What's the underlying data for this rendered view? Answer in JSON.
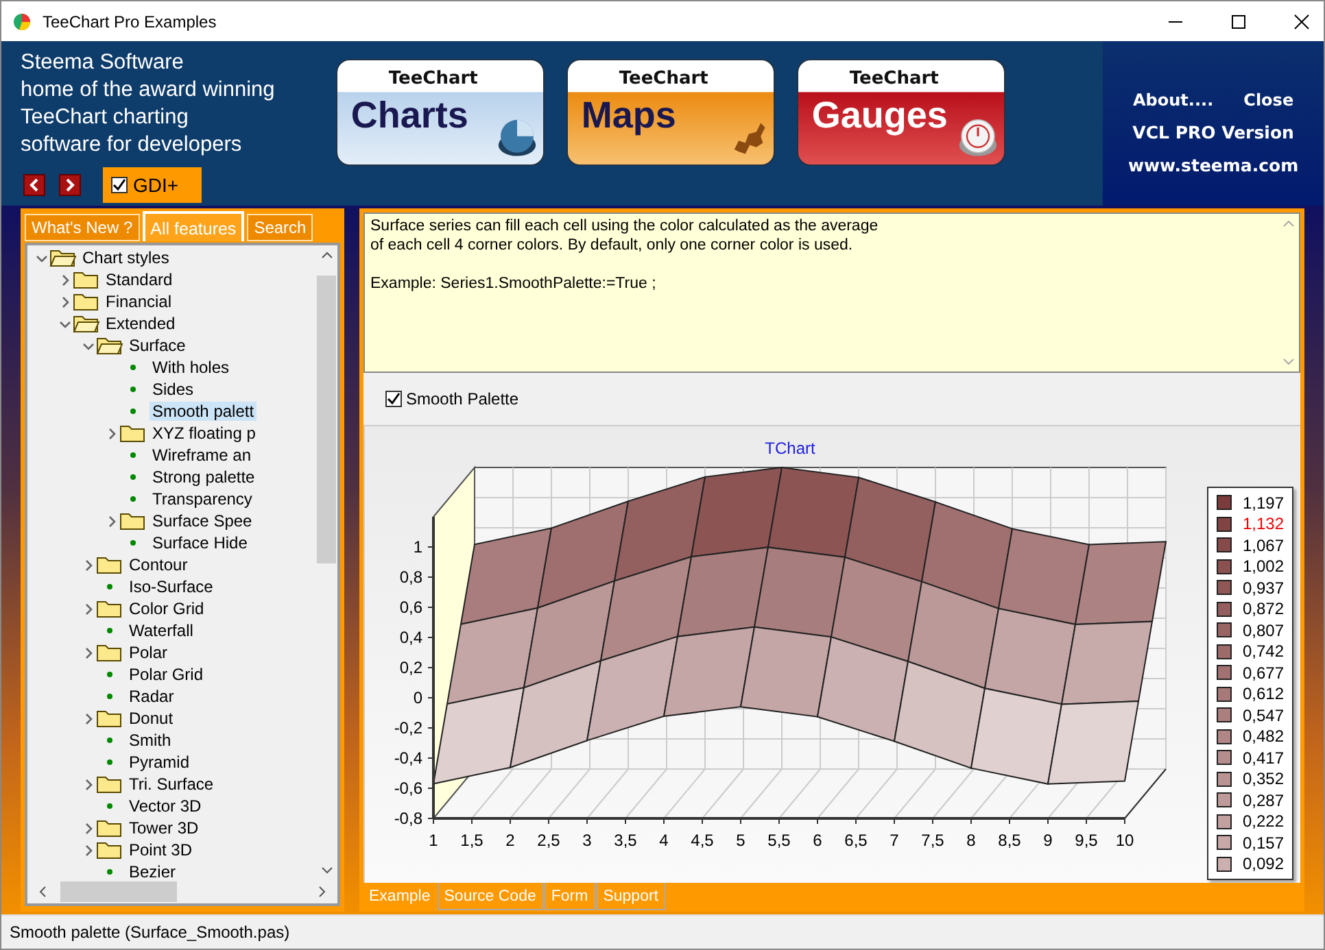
{
  "window": {
    "title": "TeeChart Pro Examples"
  },
  "header": {
    "tagline": [
      "Steema Software",
      "home of the award winning",
      "TeeChart charting",
      "software for developers"
    ],
    "gdi_checkbox": {
      "label": "GDI+",
      "checked": true
    },
    "products": [
      {
        "kind": "charts",
        "brand": "TeeChart",
        "name": "Charts"
      },
      {
        "kind": "maps",
        "brand": "TeeChart",
        "name": "Maps"
      },
      {
        "kind": "gauges",
        "brand": "TeeChart",
        "name": "Gauges"
      }
    ],
    "links": [
      "About....",
      "Close"
    ],
    "version": "VCL PRO Version",
    "website": "www.steema.com"
  },
  "sidebar": {
    "tabs": [
      {
        "label": "What's New ?",
        "selected": false
      },
      {
        "label": "All features",
        "selected": true
      },
      {
        "label": "Search",
        "selected": false
      }
    ],
    "tree": [
      {
        "label": "Chart styles",
        "kind": "folder",
        "expanded": true,
        "selected": false,
        "children": [
          {
            "label": "Standard",
            "kind": "folder",
            "expanded": false,
            "selected": false
          },
          {
            "label": "Financial",
            "kind": "folder",
            "expanded": false,
            "selected": false
          },
          {
            "label": "Extended",
            "kind": "folder",
            "expanded": true,
            "selected": false,
            "children": [
              {
                "label": "Surface",
                "kind": "folder",
                "expanded": true,
                "selected": false,
                "children": [
                  {
                    "label": "With holes",
                    "kind": "leaf",
                    "selected": false
                  },
                  {
                    "label": "Sides",
                    "kind": "leaf",
                    "selected": false
                  },
                  {
                    "label": "Smooth palett",
                    "kind": "leaf",
                    "selected": true
                  },
                  {
                    "label": "XYZ floating p",
                    "kind": "folder",
                    "expanded": false,
                    "selected": false
                  },
                  {
                    "label": "Wireframe an",
                    "kind": "leaf",
                    "selected": false
                  },
                  {
                    "label": "Strong palette",
                    "kind": "leaf",
                    "selected": false
                  },
                  {
                    "label": "Transparency",
                    "kind": "leaf",
                    "selected": false
                  },
                  {
                    "label": "Surface Spee",
                    "kind": "folder",
                    "expanded": false,
                    "selected": false
                  },
                  {
                    "label": "Surface Hide",
                    "kind": "leaf",
                    "selected": false
                  }
                ]
              },
              {
                "label": "Contour",
                "kind": "folder",
                "expanded": false,
                "selected": false
              },
              {
                "label": "Iso-Surface",
                "kind": "leaf",
                "selected": false
              },
              {
                "label": "Color Grid",
                "kind": "folder",
                "expanded": false,
                "selected": false
              },
              {
                "label": "Waterfall",
                "kind": "leaf",
                "selected": false
              },
              {
                "label": "Polar",
                "kind": "folder",
                "expanded": false,
                "selected": false
              },
              {
                "label": "Polar Grid",
                "kind": "leaf",
                "selected": false
              },
              {
                "label": "Radar",
                "kind": "leaf",
                "selected": false
              },
              {
                "label": "Donut",
                "kind": "folder",
                "expanded": false,
                "selected": false
              },
              {
                "label": "Smith",
                "kind": "leaf",
                "selected": false
              },
              {
                "label": "Pyramid",
                "kind": "leaf",
                "selected": false
              },
              {
                "label": "Tri. Surface",
                "kind": "folder",
                "expanded": false,
                "selected": false
              },
              {
                "label": "Vector 3D",
                "kind": "leaf",
                "selected": false
              },
              {
                "label": "Tower 3D",
                "kind": "folder",
                "expanded": false,
                "selected": false
              },
              {
                "label": "Point 3D",
                "kind": "folder",
                "expanded": false,
                "selected": false
              },
              {
                "label": "Bezier",
                "kind": "leaf",
                "selected": false
              }
            ]
          }
        ]
      }
    ]
  },
  "description": {
    "paragraphs": [
      [
        "Surface series can fill each cell using the color calculated as the average",
        "of each cell 4 corner colors. By default, only one corner color is used."
      ],
      [
        "Example: Series1.SmoothPalette:=True ;"
      ]
    ]
  },
  "options": {
    "smooth_palette": {
      "label": "Smooth Palette",
      "checked": true
    }
  },
  "chart": {
    "title": "TChart",
    "y_axis_labels": [
      "1",
      "0,8",
      "0,6",
      "0,4",
      "0,2",
      "0",
      "-0,2",
      "-0,4",
      "-0,6",
      "-0,8"
    ],
    "x_axis_labels": [
      "1",
      "1,5",
      "2",
      "2,5",
      "3",
      "3,5",
      "4",
      "4,5",
      "5",
      "5,5",
      "6",
      "6,5",
      "7",
      "7,5",
      "8",
      "8,5",
      "9",
      "9,5",
      "10"
    ],
    "legend": [
      {
        "label": "1,197",
        "color": "#7d3c3c",
        "highlighted": false
      },
      {
        "label": "1,132",
        "color": "#824343",
        "highlighted": true
      },
      {
        "label": "1,067",
        "color": "#864a4a",
        "highlighted": false
      },
      {
        "label": "1,002",
        "color": "#8b5050",
        "highlighted": false
      },
      {
        "label": "0,937",
        "color": "#905757",
        "highlighted": false
      },
      {
        "label": "0,872",
        "color": "#945e5e",
        "highlighted": false
      },
      {
        "label": "0,807",
        "color": "#996464",
        "highlighted": false
      },
      {
        "label": "0,742",
        "color": "#9e6b6b",
        "highlighted": false
      },
      {
        "label": "0,677",
        "color": "#a27272",
        "highlighted": false
      },
      {
        "label": "0,612",
        "color": "#a77979",
        "highlighted": false
      },
      {
        "label": "0,547",
        "color": "#ac7f7f",
        "highlighted": false
      },
      {
        "label": "0,482",
        "color": "#b18686",
        "highlighted": false
      },
      {
        "label": "0,417",
        "color": "#b58d8d",
        "highlighted": false
      },
      {
        "label": "0,352",
        "color": "#ba9494",
        "highlighted": false
      },
      {
        "label": "0,287",
        "color": "#bf9a9a",
        "highlighted": false
      },
      {
        "label": "0,222",
        "color": "#c3a1a1",
        "highlighted": false
      },
      {
        "label": "0,157",
        "color": "#c8a8a8",
        "highlighted": false
      },
      {
        "label": "0,092",
        "color": "#ccafaf",
        "highlighted": false
      }
    ]
  },
  "bottom_tabs": [
    {
      "label": "Example",
      "selected": true
    },
    {
      "label": "Source Code",
      "selected": false
    },
    {
      "label": "Form",
      "selected": false
    },
    {
      "label": "Support",
      "selected": false
    }
  ],
  "status_bar": "Smooth palette (Surface_Smooth.pas)"
}
